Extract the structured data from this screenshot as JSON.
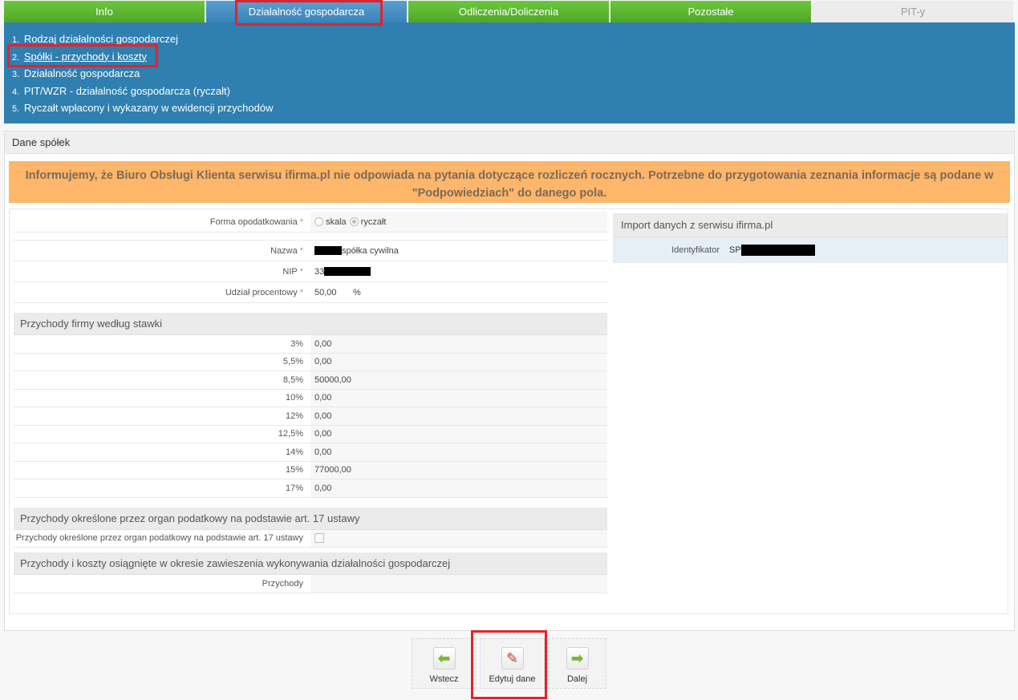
{
  "tabs": [
    {
      "label": "Info"
    },
    {
      "label": "Działalność gospodarcza"
    },
    {
      "label": "Odliczenia/Doliczenia"
    },
    {
      "label": "Pozostałe"
    },
    {
      "label": "PIT-y"
    }
  ],
  "submenu": [
    {
      "num": "1.",
      "label": "Rodzaj działalności gospodarczej"
    },
    {
      "num": "2.",
      "label": "Spółki - przychody i koszty"
    },
    {
      "num": "3.",
      "label": "Działalność gospodarcza"
    },
    {
      "num": "4.",
      "label": "PIT/WZR - działalność gospodarcza (ryczałt)"
    },
    {
      "num": "5.",
      "label": "Ryczałt wpłacony i wykazany w ewidencji przychodów"
    }
  ],
  "panel": {
    "title": "Dane spółek",
    "notice": "Informujemy, że Biuro Obsługi Klienta serwisu ifirma.pl nie odpowiada na pytania dotyczące rozliczeń rocznych. Potrzebne do przygotowania zeznania informacje są podane w \"Podpowiedziach\" do danego pola."
  },
  "form": {
    "tax_form_label": "Forma opodatkowania",
    "tax_form_options": [
      "skala",
      "ryczałt"
    ],
    "tax_form_selected": "ryczałt",
    "name_label": "Nazwa",
    "name_value": "spółka cywilna",
    "nip_label": "NIP",
    "nip_value": "33",
    "share_label": "Udział procentowy",
    "share_value": "50,00",
    "share_unit": "%",
    "required_mark": "*"
  },
  "revenue_section": {
    "title": "Przychody firmy według stawki",
    "rows": [
      {
        "rate": "3%",
        "value": "0,00"
      },
      {
        "rate": "5,5%",
        "value": "0,00"
      },
      {
        "rate": "8,5%",
        "value": "50000,00"
      },
      {
        "rate": "10%",
        "value": "0,00"
      },
      {
        "rate": "12%",
        "value": "0,00"
      },
      {
        "rate": "12,5%",
        "value": "0,00"
      },
      {
        "rate": "14%",
        "value": "0,00"
      },
      {
        "rate": "15%",
        "value": "77000,00"
      },
      {
        "rate": "17%",
        "value": "0,00"
      }
    ]
  },
  "art17_section": {
    "title": "Przychody określone przez organ podatkowy na podstawie art. 17 ustawy",
    "checkbox_label": "Przychody określone przez organ podatkowy na podstawie art. 17 ustawy"
  },
  "suspension_section": {
    "title": "Przychody i koszty osiągnięte w okresie zawieszenia wykonywania działalności gospodarczej",
    "revenue_label": "Przychody"
  },
  "import": {
    "title": "Import danych z serwisu ifirma.pl",
    "id_label": "Identyfikator",
    "id_value": "SP"
  },
  "buttons": {
    "back": "Wstecz",
    "edit": "Edytuj dane",
    "next": "Dalej"
  },
  "colors": {
    "tab_green": "#5cb832",
    "tab_blue": "#3a82b8",
    "submenu_blue": "#2f7fb0",
    "notice_orange": "#fdb66a",
    "annotation_red": "#e3232b"
  }
}
